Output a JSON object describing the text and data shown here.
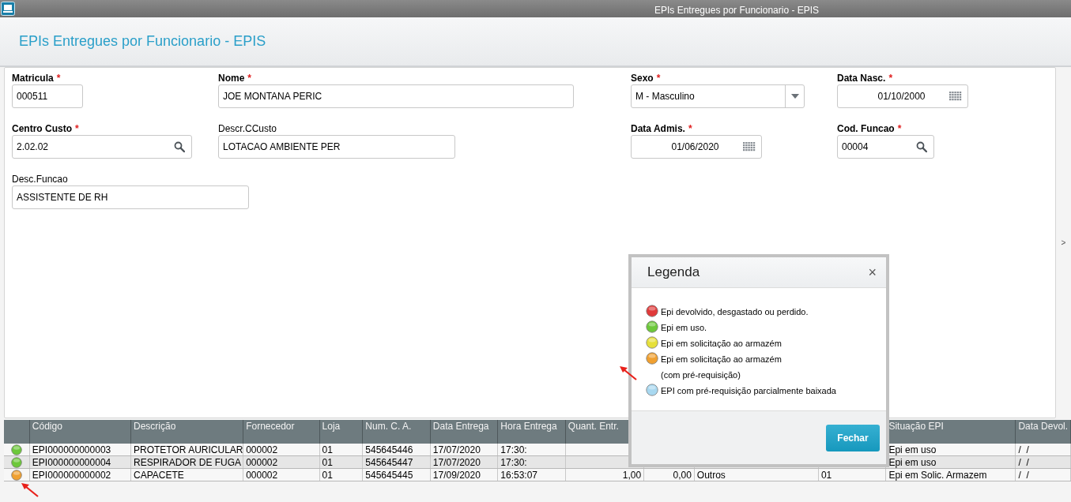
{
  "window": {
    "title": "EPIs Entregues por Funcionario - EPIS"
  },
  "header": {
    "title": "EPIs Entregues por Funcionario - EPIS"
  },
  "form": {
    "rows": [
      [
        {
          "label": "Matricula",
          "required": true,
          "mark": "*",
          "kind": "text",
          "value": "000511"
        },
        {
          "label": "Nome",
          "required": true,
          "mark": "*",
          "kind": "text",
          "value": "JOE MONTANA PERIC"
        },
        {
          "label": "Sexo",
          "required": true,
          "mark": "*",
          "kind": "select",
          "value": "M - Masculino"
        },
        {
          "label": "Data Nasc.",
          "required": true,
          "mark": "*",
          "kind": "date",
          "value": "01/10/2000"
        }
      ],
      [
        {
          "label": "Centro Custo",
          "required": true,
          "mark": "*",
          "kind": "lookup",
          "value": "2.02.02"
        },
        {
          "label": "Descr.CCusto",
          "required": false,
          "kind": "text",
          "value": "LOTACAO AMBIENTE PER"
        },
        {
          "label": "Data Admis.",
          "required": true,
          "mark": "*",
          "kind": "date",
          "value": "01/06/2020"
        },
        {
          "label": "Cod. Funcao",
          "required": true,
          "mark": "*",
          "kind": "lookup",
          "value": "00004"
        }
      ],
      [
        {
          "label": "Desc.Funcao",
          "required": false,
          "kind": "text",
          "value": "ASSISTENTE DE RH"
        }
      ]
    ]
  },
  "side_toggle": ">",
  "table": {
    "columns": [
      {
        "header": "Código"
      },
      {
        "header": "Descrição"
      },
      {
        "header": "Fornecedor"
      },
      {
        "header": "Loja"
      },
      {
        "header": "Num. C. A."
      },
      {
        "header": "Data Entrega"
      },
      {
        "header": "Hora Entrega"
      },
      {
        "header": "Quant. Entr."
      },
      {},
      {},
      {},
      {
        "header": "Situação EPI"
      },
      {
        "header": "Data Devol."
      }
    ],
    "rows": [
      {
        "color": "#6cc83a",
        "cells": [
          "EPI000000000003",
          "PROTETOR AURICULAR",
          "000002",
          "01",
          "545645446",
          "17/07/2020",
          "17:30:",
          null,
          null,
          null,
          null,
          "Epi em uso",
          "/  /"
        ]
      },
      {
        "color": "#6cc83a",
        "cells": [
          "EPI000000000004",
          "RESPIRADOR DE FUGA",
          "000002",
          "01",
          "545645447",
          "17/07/2020",
          "17:30:",
          null,
          null,
          null,
          null,
          "Epi em uso",
          "/  /"
        ]
      },
      {
        "color": "#f0a030",
        "cells": [
          "EPI000000000002",
          "CAPACETE",
          "000002",
          "01",
          "545645445",
          "17/09/2020",
          "16:53:07",
          "1,00",
          "0,00",
          "Outros",
          "01",
          "Epi em Solic. Armazem",
          "/  /"
        ]
      }
    ]
  },
  "legend_dialog": {
    "title": "Legenda",
    "close": "×",
    "items": [
      {
        "color": "#e03a3a",
        "text": "Epi devolvido, desgastado ou perdido."
      },
      {
        "color": "#6cc83a",
        "text": "Epi em uso."
      },
      {
        "color": "#e6e03a",
        "text": "Epi em solicitação ao armazém"
      },
      {
        "color": "#f0a030",
        "text": "Epi em solicitação ao armazém",
        "note": "(com pré-requisição)"
      },
      {
        "color": "#a8d8f0",
        "text": "EPI com pré-requisição parcialmente baixada"
      }
    ],
    "button": "Fechar"
  }
}
